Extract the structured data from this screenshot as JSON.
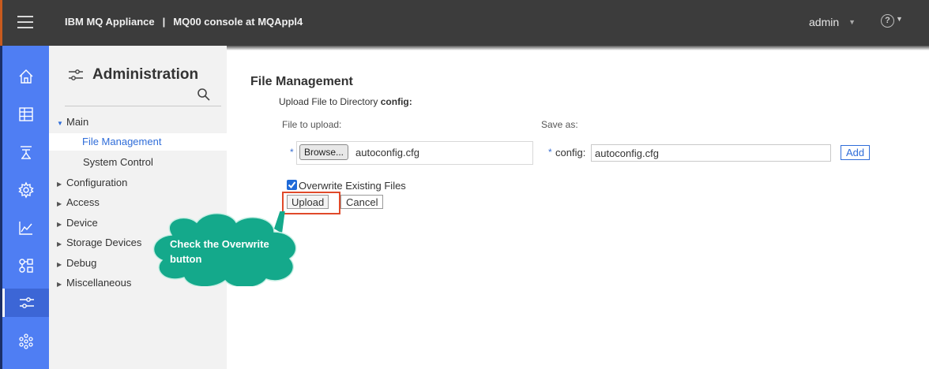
{
  "header": {
    "product": "IBM MQ Appliance",
    "separator": "|",
    "console": "MQ00 console at MQAppl4",
    "user": "admin",
    "help": "?"
  },
  "sidebar": {
    "title": "Administration",
    "tree": [
      {
        "label": "Main",
        "expanded": true,
        "children": [
          {
            "label": "File Management",
            "selected": true
          },
          {
            "label": "System Control",
            "selected": false
          }
        ]
      },
      {
        "label": "Configuration"
      },
      {
        "label": "Access"
      },
      {
        "label": "Device"
      },
      {
        "label": "Storage Devices"
      },
      {
        "label": "Debug"
      },
      {
        "label": "Miscellaneous"
      }
    ]
  },
  "leftnav": {
    "icons": [
      "home-icon",
      "table-icon",
      "queue-manager-icon",
      "gear-icon",
      "chart-icon",
      "network-icon",
      "sliders-icon",
      "cluster-icon"
    ],
    "active": "sliders-icon"
  },
  "main": {
    "title": "File Management",
    "upload_prefix": "Upload File to Directory",
    "directory": "config:",
    "file_label": "File to upload:",
    "saveas_label": "Save as:",
    "required": "*",
    "browse_label": "Browse...",
    "file_name": "autoconfig.cfg",
    "config_label": "config:",
    "saveas_value": "autoconfig.cfg",
    "add_label": "Add",
    "overwrite_label": "Overwrite Existing Files",
    "overwrite_checked": true,
    "upload_label": "Upload",
    "cancel_label": "Cancel"
  },
  "callout": {
    "text": "Check the Overwrite button",
    "color": "#14a98b"
  },
  "colors": {
    "topbar": "#3c3c3c",
    "leftnav": "#4f7ef3",
    "accent": "#2f6dd9",
    "highlight": "#e04a2a"
  }
}
